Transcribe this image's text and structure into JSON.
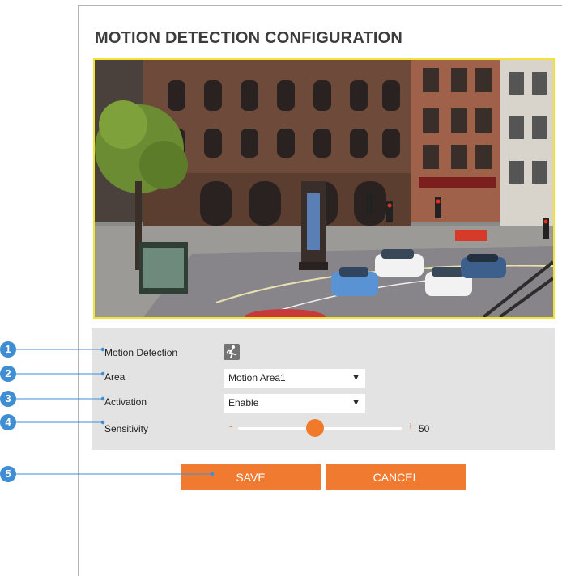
{
  "page": {
    "title": "MOTION DETECTION CONFIGURATION"
  },
  "video_preview": {
    "description_icon": "camera-feed-image",
    "border_color": "#f3e23a"
  },
  "settings": {
    "motion_detection": {
      "label": "Motion Detection",
      "icon": "running-person-icon"
    },
    "area": {
      "label": "Area",
      "value": "Motion Area1"
    },
    "activation": {
      "label": "Activation",
      "value": "Enable"
    },
    "sensitivity": {
      "label": "Sensitivity",
      "minus": "-",
      "plus": "+",
      "value": "50",
      "level_percent": 50
    }
  },
  "buttons": {
    "save": "SAVE",
    "cancel": "CANCEL"
  },
  "callouts": [
    "1",
    "2",
    "3",
    "4",
    "5"
  ],
  "colors": {
    "accent": "#f07a30",
    "callout": "#3f8ed3",
    "settings_bg": "#e3e3e3"
  }
}
